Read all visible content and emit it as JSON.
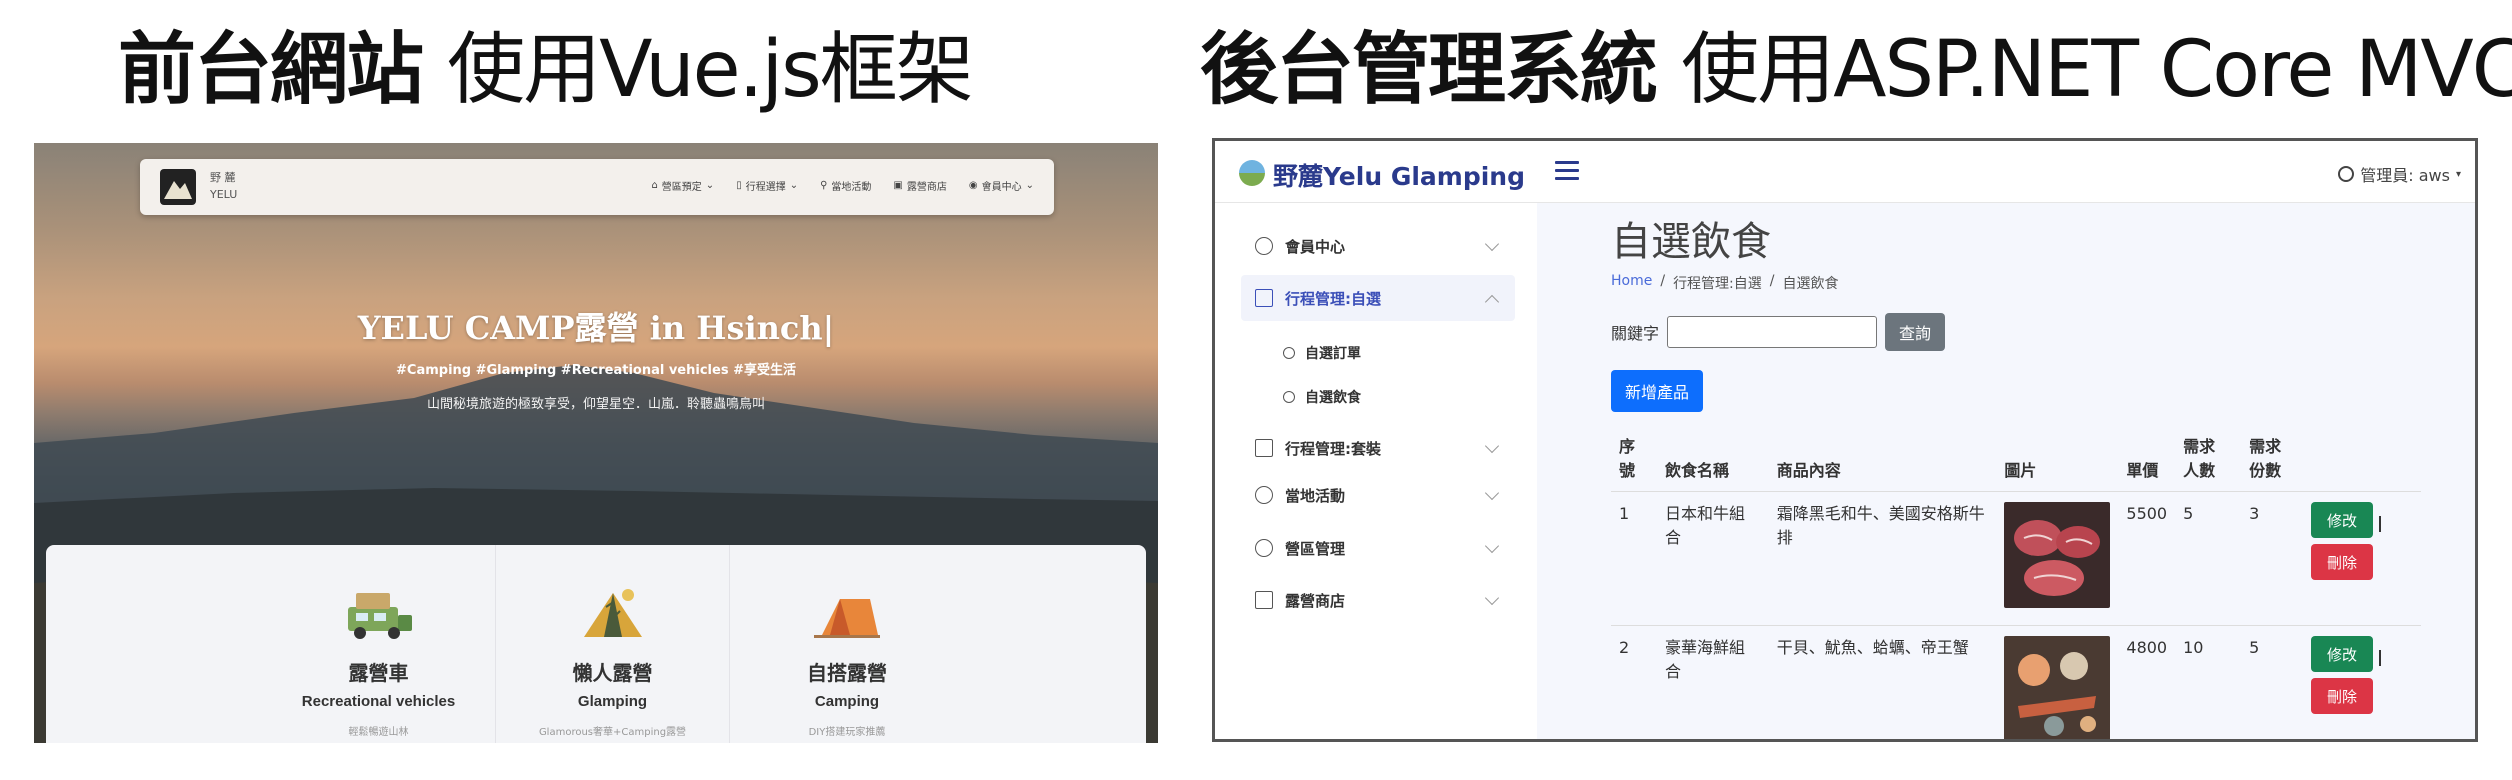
{
  "headings": {
    "left_bold": "前台網站",
    "left_light": "使用Vue.js框架",
    "right_bold": "後台管理系統",
    "right_light": "使用ASP.NET Core MVC"
  },
  "front": {
    "brand_line1": "野 麓",
    "brand_line2": "YELU",
    "menu": [
      {
        "label": "營區預定",
        "icon": "home-icon"
      },
      {
        "label": "行程選擇",
        "icon": "map-icon"
      },
      {
        "label": "當地活動",
        "icon": "hiking-icon"
      },
      {
        "label": "露營商店",
        "icon": "shop-icon"
      },
      {
        "label": "會員中心",
        "icon": "user-icon"
      }
    ],
    "hero_title": "YELU CAMP露營 in Hsinch|",
    "hero_tags": "#Camping #Glamping #Recreational vehicles #享受生活",
    "hero_sub": "山間秘境旅遊的極致享受，仰望星空．山嵐．聆聽蟲鳴鳥叫",
    "cards": [
      {
        "title": "露營車",
        "en": "Recreational vehicles",
        "desc": "輕鬆暢遊山林"
      },
      {
        "title": "懶人露營",
        "en": "Glamping",
        "desc": "Glamorous奢華+Camping露營"
      },
      {
        "title": "自搭露營",
        "en": "Camping",
        "desc": "DIY搭建玩家推薦"
      }
    ]
  },
  "admin": {
    "brand": "野麓Yelu Glamping",
    "user_label": "管理員: aws",
    "sidebar": [
      {
        "label": "會員中心",
        "icon": "user-circle-icon"
      },
      {
        "label": "行程管理:自選",
        "icon": "document-icon"
      },
      {
        "label": "行程管理:套裝",
        "icon": "checklist-icon"
      },
      {
        "label": "當地活動",
        "icon": "people-icon"
      },
      {
        "label": "營區管理",
        "icon": "person-icon"
      },
      {
        "label": "露營商店",
        "icon": "store-icon"
      }
    ],
    "submenu": [
      "自選訂單",
      "自選飲食"
    ],
    "page_title": "自選飲食",
    "breadcrumb": [
      "Home",
      "行程管理:自選",
      "自選飲食"
    ],
    "search_label": "關鍵字",
    "search_value": "",
    "search_button": "查詢",
    "add_button": "新增產品",
    "table_headers": [
      "序號",
      "飲食名稱",
      "商品內容",
      "圖片",
      "單價",
      "需求人數",
      "需求份數"
    ],
    "rows": [
      {
        "no": "1",
        "name": "日本和牛組合",
        "content": "霜降黑毛和牛、美國安格斯牛排",
        "price": "5500",
        "people": "5",
        "portions": "3"
      },
      {
        "no": "2",
        "name": "豪華海鮮組合",
        "content": "干貝、魷魚、蛤蠣、帝王蟹",
        "price": "4800",
        "people": "10",
        "portions": "5"
      }
    ],
    "edit_label": "修改",
    "delete_label": "刪除"
  }
}
